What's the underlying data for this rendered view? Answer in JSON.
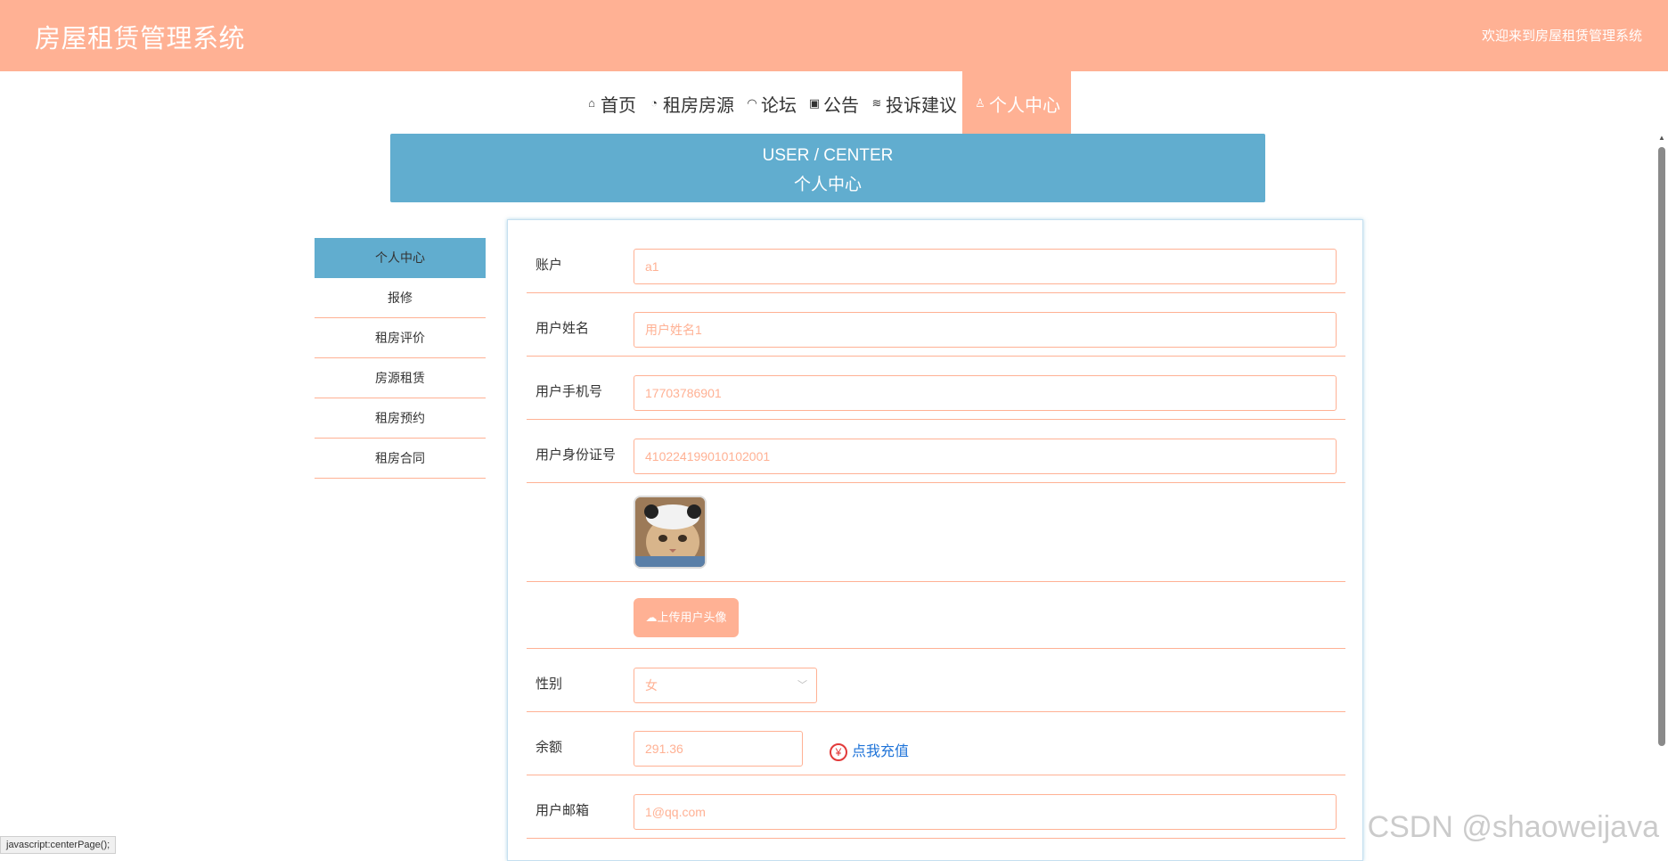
{
  "header": {
    "title": "房屋租赁管理系统",
    "welcome": "欢迎来到房屋租赁管理系统"
  },
  "nav": {
    "items": [
      {
        "label": "首页",
        "icon": "home-icon"
      },
      {
        "label": "租房房源",
        "icon": "palette-icon"
      },
      {
        "label": "论坛",
        "icon": "dashboard-icon"
      },
      {
        "label": "公告",
        "icon": "gift-icon"
      },
      {
        "label": "投诉建议",
        "icon": "layers-icon"
      },
      {
        "label": "个人中心",
        "icon": "user-icon"
      }
    ],
    "active": "个人中心"
  },
  "banner": {
    "en": "USER / CENTER",
    "zh": "个人中心"
  },
  "side_menu": {
    "items": [
      "个人中心",
      "报修",
      "租房评价",
      "房源租赁",
      "租房预约",
      "租房合同"
    ],
    "active": "个人中心"
  },
  "form": {
    "account": {
      "label": "账户",
      "value": "a1"
    },
    "name": {
      "label": "用户姓名",
      "value": "用户姓名1"
    },
    "phone": {
      "label": "用户手机号",
      "value": "17703786901"
    },
    "id_card": {
      "label": "用户身份证号",
      "value": "410224199010102001"
    },
    "upload_label": "上传用户头像",
    "gender": {
      "label": "性别",
      "value": "女"
    },
    "balance": {
      "label": "余额",
      "value": "291.36",
      "recharge": "点我充值"
    },
    "email": {
      "label": "用户邮箱",
      "value": "1@qq.com"
    }
  },
  "status_bar": "javascript:centerPage();",
  "watermark": "CSDN @shaoweijava",
  "colors": {
    "accent": "#ffb194",
    "banner": "#61adcf",
    "link": "#1e73d8"
  }
}
